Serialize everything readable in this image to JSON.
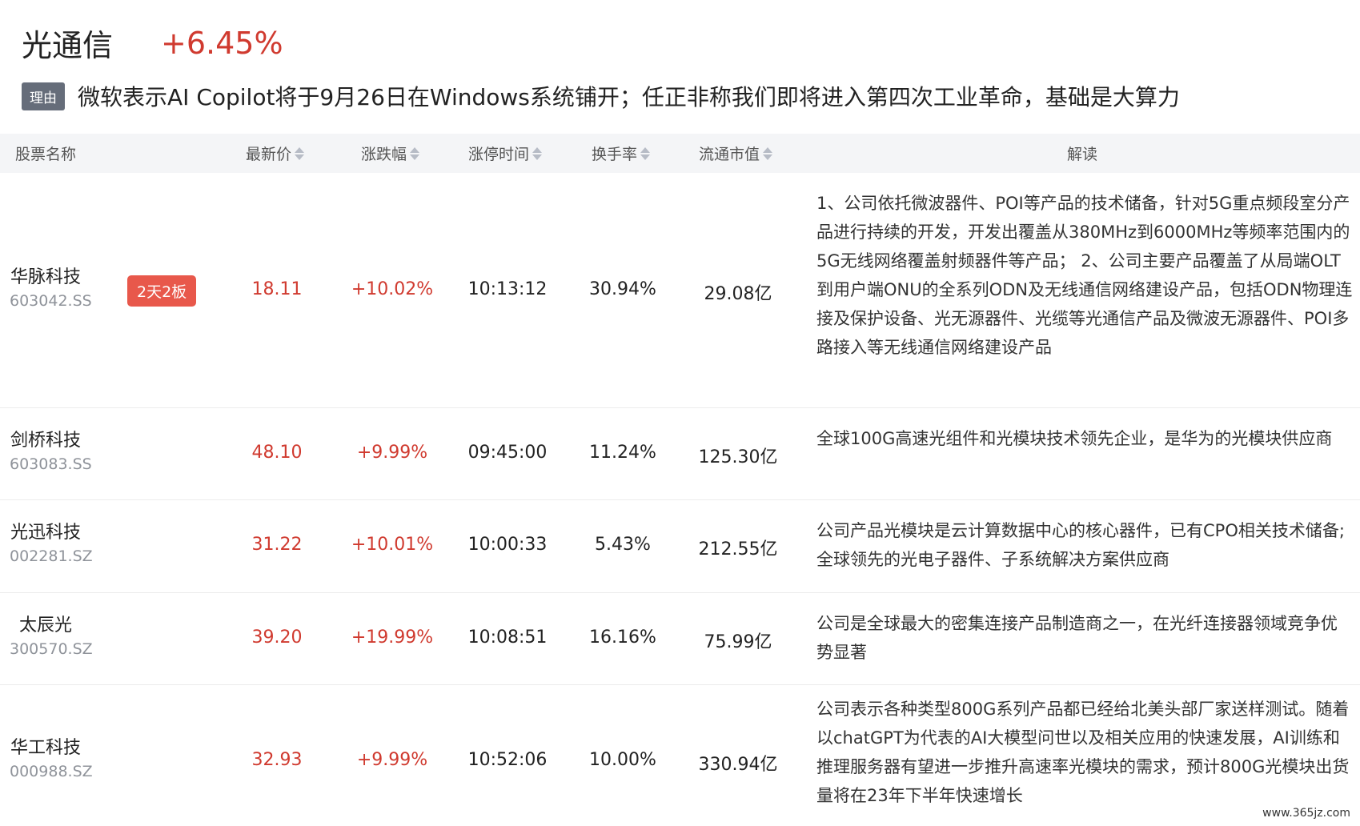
{
  "sector": {
    "name": "光通信",
    "change": "+6.45%",
    "reason_tag": "理由",
    "reason_text": "微软表示AI Copilot将于9月26日在Windows系统铺开；任正非称我们即将进入第四次工业革命，基础是大算力"
  },
  "columns": {
    "name": "股票名称",
    "price": "最新价",
    "change": "涨跌幅",
    "limit_time": "涨停时间",
    "turnover": "换手率",
    "float_cap": "流通市值",
    "analysis": "解读"
  },
  "rows": [
    {
      "name": "华脉科技",
      "code": "603042.SS",
      "badge": "2天2板",
      "price": "18.11",
      "change": "+10.02%",
      "limit_time": "10:13:12",
      "turnover": "30.94%",
      "float_cap": "29.08亿",
      "analysis": "1、公司依托微波器件、POI等产品的技术储备，针对5G重点频段室分产品进行持续的开发，开发出覆盖从380MHz到6000MHz等频率范围内的5G无线网络覆盖射频器件等产品； 2、公司主要产品覆盖了从局端OLT到用户端ONU的全系列ODN及无线通信网络建设产品，包括ODN物理连接及保护设备、光无源器件、光缆等光通信产品及微波无源器件、POI多路接入等无线通信网络建设产品"
    },
    {
      "name": "剑桥科技",
      "code": "603083.SS",
      "badge": "",
      "price": "48.10",
      "change": "+9.99%",
      "limit_time": "09:45:00",
      "turnover": "11.24%",
      "float_cap": "125.30亿",
      "analysis": "全球100G高速光组件和光模块技术领先企业，是华为的光模块供应商"
    },
    {
      "name": "光迅科技",
      "code": "002281.SZ",
      "badge": "",
      "price": "31.22",
      "change": "+10.01%",
      "limit_time": "10:00:33",
      "turnover": "5.43%",
      "float_cap": "212.55亿",
      "analysis": "公司产品光模块是云计算数据中心的核心器件，已有CPO相关技术储备;全球领先的光电子器件、子系统解决方案供应商"
    },
    {
      "name": "太辰光",
      "code": "300570.SZ",
      "badge": "",
      "price": "39.20",
      "change": "+19.99%",
      "limit_time": "10:08:51",
      "turnover": "16.16%",
      "float_cap": "75.99亿",
      "analysis": "公司是全球最大的密集连接产品制造商之一，在光纤连接器领域竞争优势显著"
    },
    {
      "name": "华工科技",
      "code": "000988.SZ",
      "badge": "",
      "price": "32.93",
      "change": "+9.99%",
      "limit_time": "10:52:06",
      "turnover": "10.00%",
      "float_cap": "330.94亿",
      "analysis": "公司表示各种类型800G系列产品都已经给北美头部厂家送样测试。随着以chatGPT为代表的AI大模型问世以及相关应用的快速发展，AI训练和推理服务器有望进一步推升高速率光模块的需求，预计800G光模块出货量将在23年下半年快速增长"
    }
  ],
  "watermark": "www.365jz.com",
  "colors": {
    "up_red": "#d03a2f",
    "badge_red": "#e8584b",
    "reason_tag_bg": "#666d7a",
    "header_bg": "#f4f5f7"
  }
}
